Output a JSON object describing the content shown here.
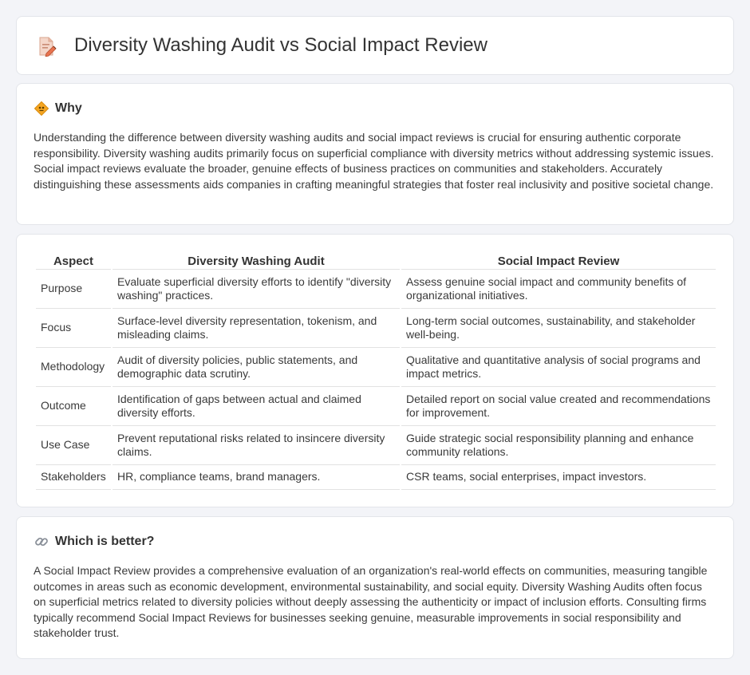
{
  "header": {
    "title": "Diversity Washing Audit vs Social Impact Review",
    "icon": "document-pencil-icon"
  },
  "why": {
    "heading": "Why",
    "icon": "warning-sign-icon",
    "text": "Understanding the difference between diversity washing audits and social impact reviews is crucial for ensuring authentic corporate responsibility. Diversity washing audits primarily focus on superficial compliance with diversity metrics without addressing systemic issues. Social impact reviews evaluate the broader, genuine effects of business practices on communities and stakeholders. Accurately distinguishing these assessments aids companies in crafting meaningful strategies that foster real inclusivity and positive societal change."
  },
  "table": {
    "headers": [
      "Aspect",
      "Diversity Washing Audit",
      "Social Impact Review"
    ],
    "rows": [
      [
        "Purpose",
        "Evaluate superficial diversity efforts to identify \"diversity washing\" practices.",
        "Assess genuine social impact and community benefits of organizational initiatives."
      ],
      [
        "Focus",
        "Surface-level diversity representation, tokenism, and misleading claims.",
        "Long-term social outcomes, sustainability, and stakeholder well-being."
      ],
      [
        "Methodology",
        "Audit of diversity policies, public statements, and demographic data scrutiny.",
        "Qualitative and quantitative analysis of social programs and impact metrics."
      ],
      [
        "Outcome",
        "Identification of gaps between actual and claimed diversity efforts.",
        "Detailed report on social value created and recommendations for improvement."
      ],
      [
        "Use Case",
        "Prevent reputational risks related to insincere diversity claims.",
        "Guide strategic social responsibility planning and enhance community relations."
      ],
      [
        "Stakeholders",
        "HR, compliance teams, brand managers.",
        "CSR teams, social enterprises, impact investors."
      ]
    ]
  },
  "better": {
    "heading": "Which is better?",
    "icon": "link-icon",
    "text": "A Social Impact Review provides a comprehensive evaluation of an organization's real-world effects on communities, measuring tangible outcomes in areas such as economic development, environmental sustainability, and social equity. Diversity Washing Audits often focus on superficial metrics related to diversity policies without deeply assessing the authenticity or impact of inclusion efforts. Consulting firms typically recommend Social Impact Reviews for businesses seeking genuine, measurable improvements in social responsibility and stakeholder trust."
  }
}
